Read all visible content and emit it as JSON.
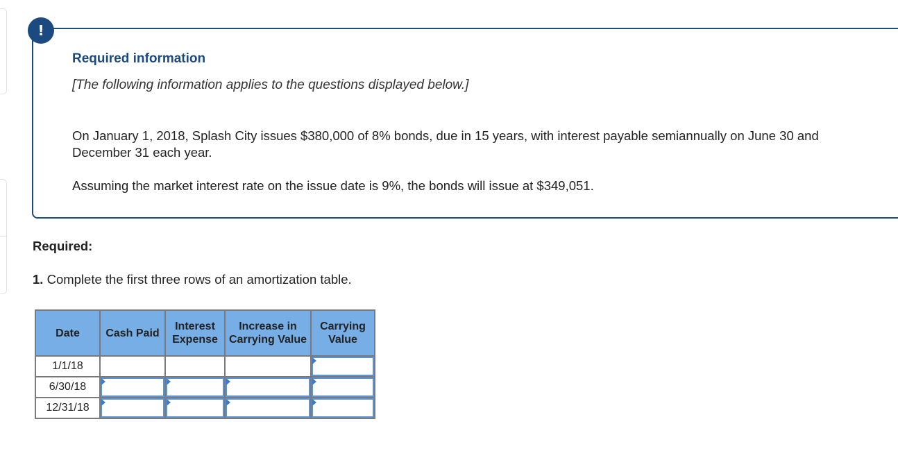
{
  "info": {
    "badge_icon": "!",
    "title": "Required information",
    "subtitle": "[The following information applies to the questions displayed below.]",
    "paragraph1": "On January 1, 2018, Splash City issues $380,000 of 8% bonds, due in 15 years, with interest payable semiannually on June 30 and December 31 each year.",
    "paragraph2": "Assuming the market interest rate on the issue date is 9%, the bonds will issue at $349,051."
  },
  "required": {
    "label": "Required:",
    "question_number": "1.",
    "question_text": " Complete the first three rows of an amortization table."
  },
  "table": {
    "headers": [
      "Date",
      "Cash Paid",
      "Interest Expense",
      "Increase in Carrying Value",
      "Carrying Value"
    ],
    "rows": [
      {
        "date": "1/1/18",
        "cash_paid": "",
        "interest_expense": "",
        "increase": "",
        "carrying_value": ""
      },
      {
        "date": "6/30/18",
        "cash_paid": "",
        "interest_expense": "",
        "increase": "",
        "carrying_value": ""
      },
      {
        "date": "12/31/18",
        "cash_paid": "",
        "interest_expense": "",
        "increase": "",
        "carrying_value": ""
      }
    ]
  },
  "colors": {
    "accent": "#1a4a80",
    "header_bg": "#77aee5",
    "input_border": "#5b93d4"
  }
}
